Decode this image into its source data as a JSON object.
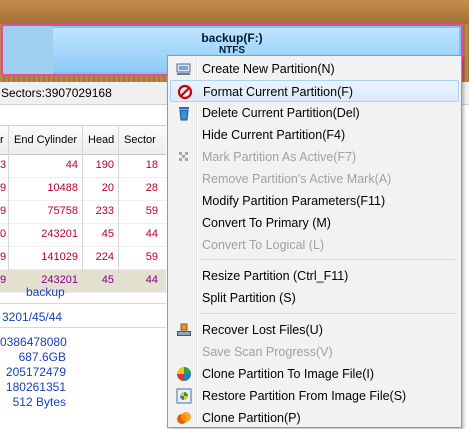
{
  "disk": {
    "partition_name": "backup(F:)",
    "partition_fs": "NTFS",
    "sectors_text": "Sectors:3907029168"
  },
  "table": {
    "headers": [
      "r",
      "End Cylinder",
      "Head",
      "Sector"
    ],
    "rows": [
      {
        "c0": "3",
        "end_cylinder": "44",
        "head": "190",
        "sector": "18"
      },
      {
        "c0": "9",
        "end_cylinder": "10488",
        "head": "20",
        "sector": "28"
      },
      {
        "c0": "9",
        "end_cylinder": "75758",
        "head": "233",
        "sector": "59"
      },
      {
        "c0": "0",
        "end_cylinder": "243201",
        "head": "45",
        "sector": "44"
      },
      {
        "c0": "9",
        "end_cylinder": "141029",
        "head": "224",
        "sector": "59"
      },
      {
        "c0": "9",
        "end_cylinder": "243201",
        "head": "45",
        "sector": "44"
      }
    ]
  },
  "info": {
    "label": "backup",
    "chs": "3201/45/44",
    "values": [
      "0386478080",
      "687.6GB",
      "205172479",
      "180261351",
      "512 Bytes"
    ]
  },
  "menu": {
    "items": [
      {
        "label": "Create New Partition(N)",
        "icon": "new-partition-icon",
        "disabled": false,
        "hover": false
      },
      {
        "label": "Format Current Partition(F)",
        "icon": "format-icon",
        "disabled": false,
        "hover": true
      },
      {
        "label": "Delete Current Partition(Del)",
        "icon": "trash-icon",
        "disabled": false,
        "hover": false
      },
      {
        "label": "Hide Current Partition(F4)",
        "icon": "",
        "disabled": false,
        "hover": false
      },
      {
        "label": "Mark Partition As Active(F7)",
        "icon": "active-mark-icon",
        "disabled": true,
        "hover": false
      },
      {
        "label": "Remove Partition's Active Mark(A)",
        "icon": "",
        "disabled": true,
        "hover": false
      },
      {
        "label": "Modify Partition Parameters(F11)",
        "icon": "",
        "disabled": false,
        "hover": false
      },
      {
        "label": "Convert To Primary (M)",
        "icon": "",
        "disabled": false,
        "hover": false
      },
      {
        "label": "Convert To Logical (L)",
        "icon": "",
        "disabled": true,
        "hover": false
      },
      {
        "label": "Resize Partition (Ctrl_F11)",
        "icon": "",
        "disabled": false,
        "hover": false
      },
      {
        "label": "Split Partition (S)",
        "icon": "",
        "disabled": false,
        "hover": false
      },
      {
        "label": "Recover Lost Files(U)",
        "icon": "recover-icon",
        "disabled": false,
        "hover": false
      },
      {
        "label": "Save Scan Progress(V)",
        "icon": "",
        "disabled": true,
        "hover": false
      },
      {
        "label": "Clone Partition To Image File(I)",
        "icon": "image-file-icon",
        "disabled": false,
        "hover": false
      },
      {
        "label": "Restore Partition From Image File(S)",
        "icon": "restore-icon",
        "disabled": false,
        "hover": false
      },
      {
        "label": "Clone Partition(P)",
        "icon": "clone-icon",
        "disabled": false,
        "hover": false
      }
    ]
  }
}
